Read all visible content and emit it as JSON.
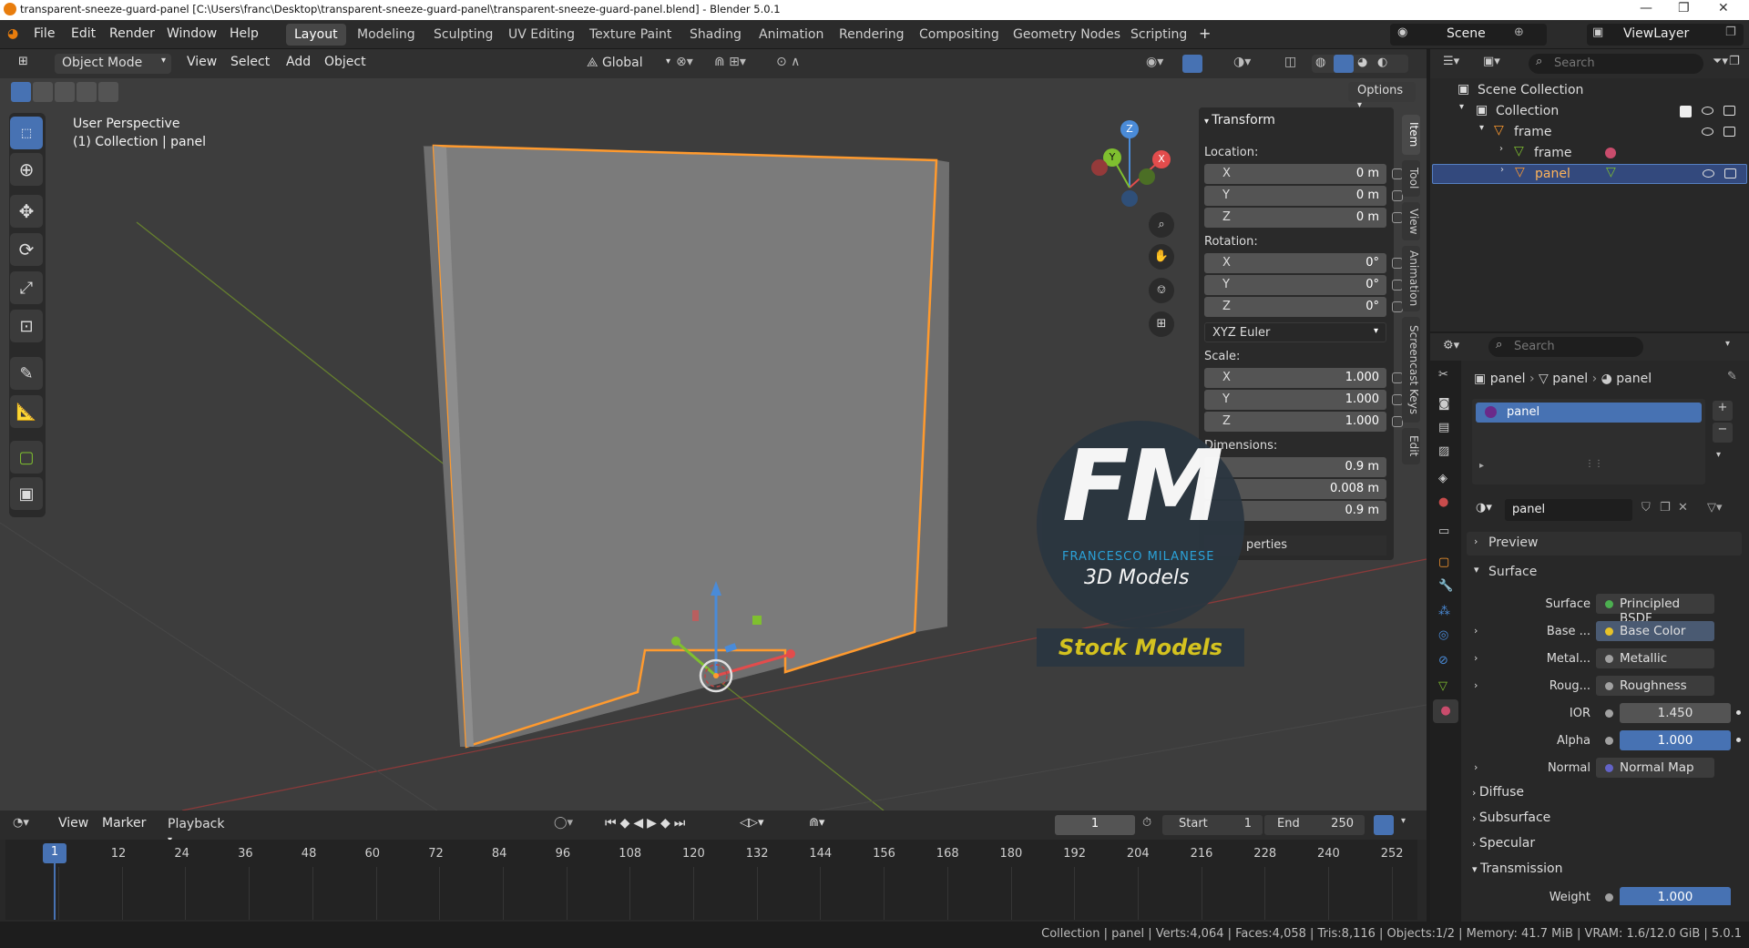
{
  "titlebar": {
    "title": "transparent-sneeze-guard-panel [C:\\Users\\franc\\Desktop\\transparent-sneeze-guard-panel\\transparent-sneeze-guard-panel.blend] - Blender 5.0.1"
  },
  "menu": [
    "File",
    "Edit",
    "Render",
    "Window",
    "Help"
  ],
  "workspaces": [
    "Layout",
    "Modeling",
    "Sculpting",
    "UV Editing",
    "Texture Paint",
    "Shading",
    "Animation",
    "Rendering",
    "Compositing",
    "Geometry Nodes",
    "Scripting"
  ],
  "active_workspace": "Layout",
  "scene": {
    "label": "Scene",
    "viewlayer": "ViewLayer"
  },
  "viewport": {
    "mode": "Object Mode",
    "menus": [
      "View",
      "Select",
      "Add",
      "Object"
    ],
    "orientation": "Global",
    "options_label": "Options",
    "overlay_line1": "User Perspective",
    "overlay_line2": "(1) Collection | panel",
    "gizmo_axes": [
      "Z",
      "Y",
      "X"
    ]
  },
  "npanel": {
    "header": "Transform",
    "location_label": "Location:",
    "location": [
      {
        "axis": "X",
        "value": "0 m"
      },
      {
        "axis": "Y",
        "value": "0 m"
      },
      {
        "axis": "Z",
        "value": "0 m"
      }
    ],
    "rotation_label": "Rotation:",
    "rotation": [
      {
        "axis": "X",
        "value": "0°"
      },
      {
        "axis": "Y",
        "value": "0°"
      },
      {
        "axis": "Z",
        "value": "0°"
      }
    ],
    "rotation_mode": "XYZ Euler",
    "scale_label": "Scale:",
    "scale": [
      {
        "axis": "X",
        "value": "1.000"
      },
      {
        "axis": "Y",
        "value": "1.000"
      },
      {
        "axis": "Z",
        "value": "1.000"
      }
    ],
    "dimensions_label": "Dimensions:",
    "dimensions": [
      {
        "value": "0.9 m"
      },
      {
        "value": "0.008 m"
      },
      {
        "value": "0.9 m"
      }
    ],
    "properties_label": "perties",
    "tabs": [
      "Item",
      "Tool",
      "View",
      "Animation",
      "Screencast Keys",
      "Edit"
    ]
  },
  "watermark": {
    "initials": "FM",
    "name": "FRANCESCO MILANESE",
    "subtitle": "3D Models",
    "banner": "Stock Models"
  },
  "outliner": {
    "search_placeholder": "Search",
    "items": [
      {
        "label": "Scene Collection",
        "depth": 0
      },
      {
        "label": "Collection",
        "depth": 1
      },
      {
        "label": "frame",
        "depth": 2
      },
      {
        "label": "frame",
        "depth": 3
      },
      {
        "label": "panel",
        "depth": 3,
        "selected": true
      }
    ]
  },
  "properties": {
    "search_placeholder": "Search",
    "breadcrumb": [
      "panel",
      "panel",
      "panel"
    ],
    "material_slot": "panel",
    "material_name": "panel",
    "sections": {
      "preview": "Preview",
      "surface": "Surface",
      "diffuse": "Diffuse",
      "subsurface": "Subsurface",
      "specular": "Specular",
      "transmission": "Transmission"
    },
    "surface_rows": [
      {
        "label": "Surface",
        "value": "Principled BSDF",
        "dot": "#4caf50"
      },
      {
        "label": "Base ...",
        "value": "Base Color",
        "dot": "#e6c229"
      },
      {
        "label": "Metal...",
        "value": "Metallic",
        "dot": "#a1a1a1"
      },
      {
        "label": "Roug...",
        "value": "Roughness",
        "dot": "#a1a1a1"
      },
      {
        "label": "IOR",
        "value": "1.450",
        "dot": "#a1a1a1"
      },
      {
        "label": "Alpha",
        "value": "1.000",
        "dot": "#a1a1a1"
      },
      {
        "label": "Normal",
        "value": "Normal Map",
        "dot": "#6363c7"
      }
    ],
    "weight_row": {
      "label": "Weight",
      "value": "1.000"
    }
  },
  "timeline": {
    "menus": [
      "View",
      "Marker",
      "Playback"
    ],
    "current_frame": "1",
    "start_label": "Start",
    "start": "1",
    "end_label": "End",
    "end": "250",
    "ticks": [
      "1",
      "12",
      "24",
      "36",
      "48",
      "60",
      "72",
      "84",
      "96",
      "108",
      "120",
      "132",
      "144",
      "156",
      "168",
      "180",
      "192",
      "204",
      "216",
      "228",
      "240",
      "252"
    ]
  },
  "statusbar": {
    "text": "Collection | panel | Verts:4,064 | Faces:4,058 | Tris:8,116 | Objects:1/2 | Memory: 41.7 MiB | VRAM: 1.6/12.0 GiB | 5.0.1"
  },
  "colors": {
    "accent": "#4772b3",
    "selection_orange": "#ff9a2e",
    "bg": "#3d3d3d"
  }
}
